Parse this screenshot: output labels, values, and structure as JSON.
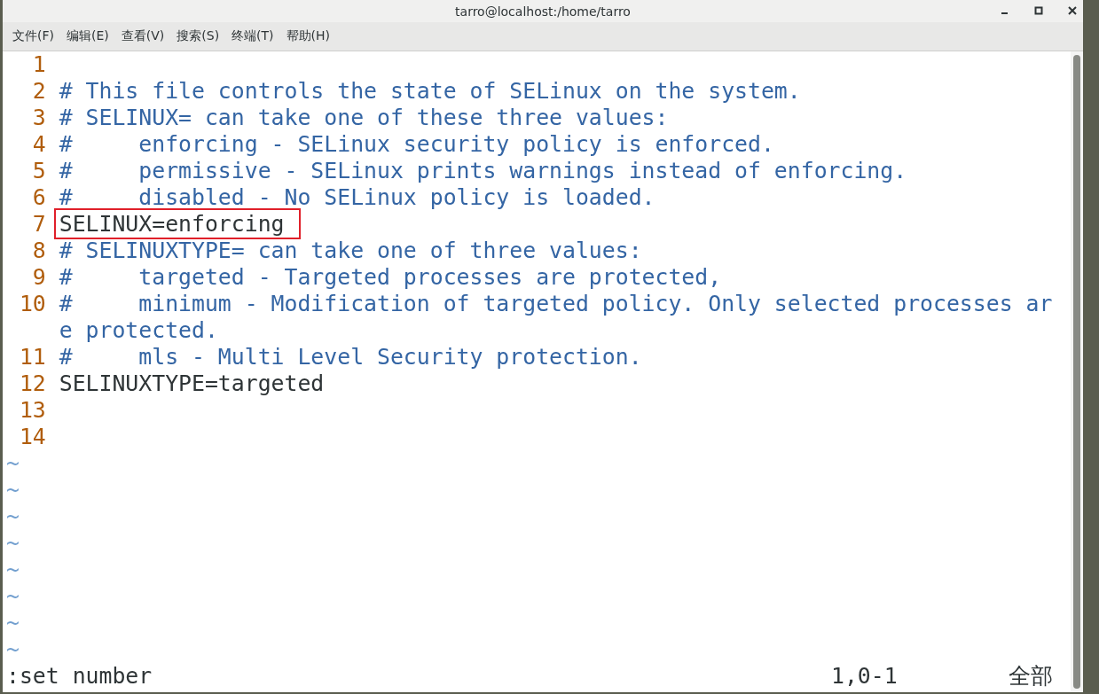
{
  "window": {
    "title": "tarro@localhost:/home/tarro"
  },
  "menu": [
    "文件(F)",
    "编辑(E)",
    "查看(V)",
    "搜索(S)",
    "终端(T)",
    "帮助(H)"
  ],
  "lines": [
    {
      "number": "1"
    },
    {
      "number": "2",
      "kind": "comment",
      "text": "# This file controls the state of SELinux on the system.",
      "highlighted": false
    },
    {
      "number": "3",
      "kind": "comment",
      "text": "# SELINUX= can take one of these three values:",
      "highlighted": false
    },
    {
      "number": "4",
      "kind": "comment",
      "text": "#     enforcing - SELinux security policy is enforced.",
      "highlighted": false
    },
    {
      "number": "5",
      "kind": "comment",
      "text": "#     permissive - SELinux prints warnings instead of enforcing.",
      "highlighted": false
    },
    {
      "number": "6",
      "kind": "comment",
      "text": "#     disabled - No SELinux policy is loaded.",
      "highlighted": false
    },
    {
      "number": "7",
      "kind": "code",
      "text": "SELINUX=enforcing",
      "highlighted": true
    },
    {
      "number": "8",
      "kind": "comment",
      "text": "# SELINUXTYPE= can take one of three values:",
      "highlighted": false
    },
    {
      "number": "9",
      "kind": "comment",
      "text": "#     targeted - Targeted processes are protected,",
      "highlighted": false
    },
    {
      "number": "10",
      "kind": "comment",
      "text": "#     minimum - Modification of targeted policy. Only selected processes are protected.",
      "highlighted": false
    },
    {
      "number": "11",
      "kind": "comment",
      "text": "#     mls - Multi Level Security protection.",
      "highlighted": false
    },
    {
      "number": "12",
      "kind": "code",
      "text": "SELINUXTYPE=targeted",
      "highlighted": false
    },
    {
      "number": "13"
    },
    {
      "number": "14"
    }
  ],
  "filler": [
    "~",
    "~",
    "~",
    "~",
    "~",
    "~",
    "~",
    "~"
  ],
  "status": {
    "command": ":set number",
    "position": "1,0-1",
    "scroll": "全部"
  }
}
